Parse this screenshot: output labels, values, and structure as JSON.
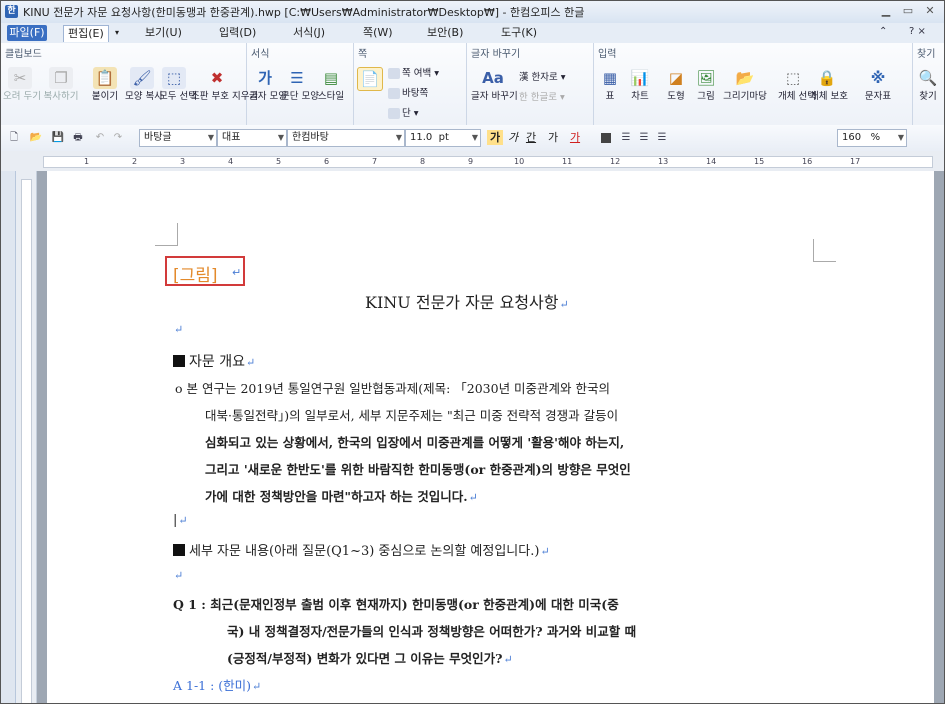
{
  "window": {
    "title": "KINU 전문가 자문 요청사항(한미동맹과 한중관계).hwp [C:₩Users₩Administrator₩Desktop₩] - 한컴오피스 한글"
  },
  "menu": {
    "file": "파일(F)",
    "items": [
      "편집(E)",
      "보기(U)",
      "입력(D)",
      "서식(J)",
      "쪽(W)",
      "보안(B)",
      "도구(K)"
    ],
    "help": "? ×"
  },
  "ribbon": {
    "groups": {
      "clipboard": "클립보드",
      "format": "서식",
      "page": "쪽",
      "find_replace": "글자 바꾸기",
      "input": "입력",
      "find": "찾기"
    },
    "clipboard_buttons": [
      "오려 두기",
      "복사하기",
      "붙이기",
      "모양 복사",
      "모두 선택",
      "조판 부호 지우기"
    ],
    "format_buttons": [
      "글자 모양",
      "문단 모양",
      "스타일"
    ],
    "page_options": [
      "쪽 여백",
      "바탕쪽",
      "단"
    ],
    "char_buttons": [
      "글자 바꾸기",
      "한자로",
      "한글로"
    ],
    "input_buttons": [
      "표",
      "차트",
      "도형",
      "그림",
      "그리기마당",
      "개체 선택",
      "개체 보호",
      "문자표",
      "찾기"
    ]
  },
  "toolbar": {
    "style": "바탕글",
    "lang": "대표",
    "font": "한컴바탕",
    "size": "11.0",
    "size_unit": "pt",
    "format_letters": [
      "가",
      "가",
      "간",
      "가",
      "가"
    ],
    "zoom": "160",
    "zoom_unit": "%"
  },
  "ruler": {
    "numbers": [
      "1",
      "2",
      "3",
      "4",
      "5",
      "6",
      "7",
      "8",
      "9",
      "10",
      "11",
      "12",
      "13",
      "14",
      "15",
      "16",
      "17"
    ]
  },
  "document": {
    "figure_label": "[그림]",
    "title": "KINU 전문가 자문 요청사항",
    "section1_heading": "자문 개요",
    "para1": [
      "o 본 연구는 2019년 통일연구원 일반협동과제(제목: 「2030년 미중관계와 한국의",
      "대북·통일전략」)의 일부로서, 세부 지문주제는 \"최근 미중 전략적 경쟁과 갈등이",
      "심화되고 있는 상황에서, 한국의 입장에서 미중관계를 어떻게 '활용'해야 하는지,",
      "그리고 '새로운 한반도'를 위한 바람직한 한미동맹(or 한중관계)의 방향은 무엇인",
      "가에 대한 정책방안을 마련\"하고자 하는 것입니다."
    ],
    "section2_heading": "세부 자문 내용(아래 질문(Q1~3) 중심으로 논의할 예정입니다.)",
    "q1": [
      "Q 1 : 최근(문재인정부 출범 이후 현재까지) 한미동맹(or 한중관계)에 대한 미국(중",
      "국) 내 정책결정자/전문가들의 인식과 정책방향은 어떠한가? 과거와 비교할 때",
      "(긍정적/부정적) 변화가 있다면 그 이유는 무엇인가?"
    ],
    "a1": "A 1-1 : (한미)"
  },
  "colors": {
    "accent": "#3a6fc2",
    "figure_label": "#e38a2b",
    "figure_border": "#d23a3a",
    "answer_text": "#3b6fd6"
  }
}
